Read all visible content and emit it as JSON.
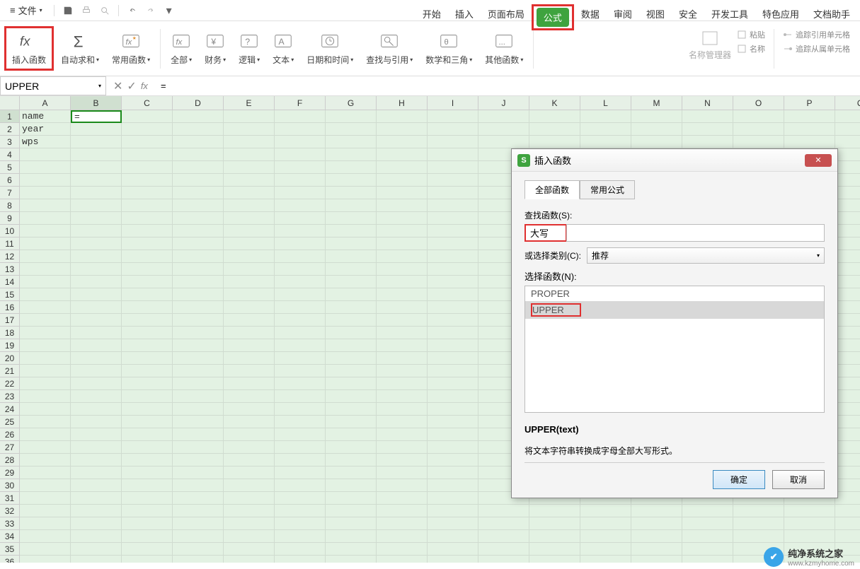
{
  "topbar": {
    "file": "文件",
    "tabs": [
      "开始",
      "插入",
      "页面布局",
      "公式",
      "数据",
      "审阅",
      "视图",
      "安全",
      "开发工具",
      "特色应用",
      "文档助手"
    ],
    "active_tab_index": 3
  },
  "ribbon": {
    "insert_fn": "插入函数",
    "autosum": "自动求和",
    "common": "常用函数",
    "all": "全部",
    "finance": "财务",
    "logic": "逻辑",
    "text": "文本",
    "datetime": "日期和时间",
    "lookup": "查找与引用",
    "math": "数学和三角",
    "other": "其他函数",
    "name_mgr": "名称管理器",
    "paste_btn": "粘贴",
    "name_label": "名称",
    "trace_prec": "追踪引用单元格",
    "trace_dep": "追踪从属单元格"
  },
  "formula_bar": {
    "name_box": "UPPER",
    "formula": "="
  },
  "columns": [
    "A",
    "B",
    "C",
    "D",
    "E",
    "F",
    "G",
    "H",
    "I",
    "J",
    "K",
    "L",
    "M",
    "N",
    "O",
    "P",
    "Q"
  ],
  "row_count": 36,
  "cells": {
    "A1": "name",
    "A2": "year",
    "A3": "wps",
    "B1": "="
  },
  "dialog": {
    "title": "插入函数",
    "tab_all": "全部函数",
    "tab_common": "常用公式",
    "search_label": "查找函数(S):",
    "search_value": "大写",
    "category_label": "或选择类别(C):",
    "category_value": "推荐",
    "select_label": "选择函数(N):",
    "fn_list": [
      "PROPER",
      "UPPER"
    ],
    "selected_fn_index": 1,
    "signature": "UPPER(text)",
    "description": "将文本字符串转换成字母全部大写形式。",
    "ok": "确定",
    "cancel": "取消"
  },
  "watermark": {
    "name": "纯净系统之家",
    "url": "www.kzmyhome.com"
  }
}
